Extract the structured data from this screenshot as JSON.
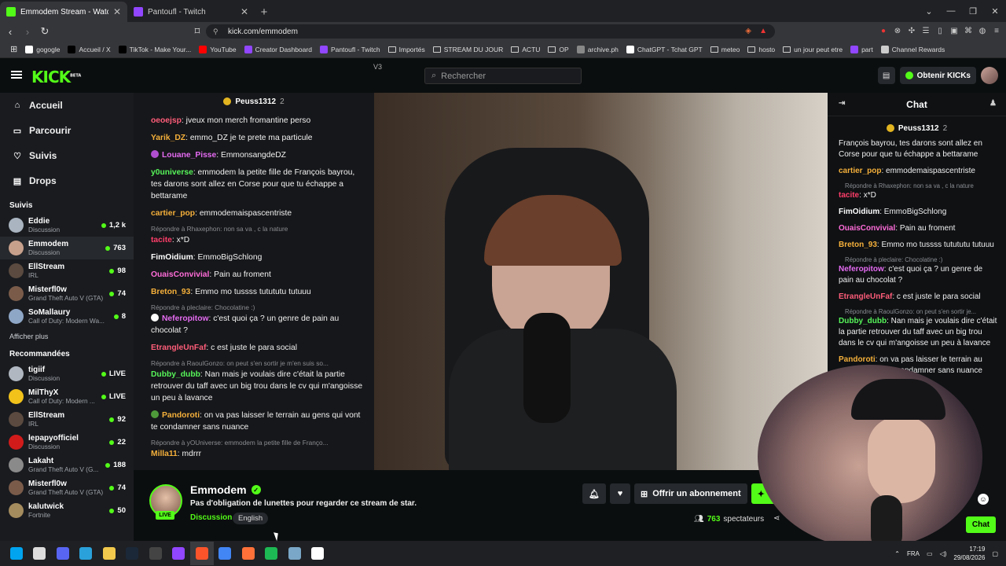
{
  "browser": {
    "tabs": [
      {
        "title": "Emmodem Stream - Watch L",
        "favicon_color": "#53fc18",
        "active": true
      },
      {
        "title": "Pantoufl - Twitch",
        "favicon_color": "#9146ff",
        "active": false
      }
    ],
    "url": "kick.com/emmodem",
    "bookmarks": [
      {
        "label": "gogogle",
        "icon": "google-icon",
        "color": "#ffffff"
      },
      {
        "label": "Accueil / X",
        "icon": "x-icon",
        "color": "#000000"
      },
      {
        "label": "TikTok - Make Your...",
        "icon": "tiktok-icon",
        "color": "#000000"
      },
      {
        "label": "YouTube",
        "icon": "youtube-icon",
        "color": "#ff0000"
      },
      {
        "label": "Creator Dashboard",
        "icon": "twitch-icon",
        "color": "#9146ff"
      },
      {
        "label": "Pantoufl - Twitch",
        "icon": "twitch-icon",
        "color": "#9146ff"
      },
      {
        "label": "Importés",
        "icon": "folder-icon",
        "color": ""
      },
      {
        "label": "STREAM DU JOUR",
        "icon": "folder-icon",
        "color": ""
      },
      {
        "label": "ACTU",
        "icon": "folder-icon",
        "color": ""
      },
      {
        "label": "OP",
        "icon": "folder-icon",
        "color": ""
      },
      {
        "label": "archive.ph",
        "icon": "archive-icon",
        "color": "#888888"
      },
      {
        "label": "ChatGPT - Tchat GPT",
        "icon": "chatgpt-icon",
        "color": "#ffffff"
      },
      {
        "label": "meteo",
        "icon": "folder-icon",
        "color": ""
      },
      {
        "label": "hosto",
        "icon": "folder-icon",
        "color": ""
      },
      {
        "label": "un jour peut etre",
        "icon": "folder-icon",
        "color": ""
      },
      {
        "label": "part",
        "icon": "twitch-icon",
        "color": "#9146ff"
      },
      {
        "label": "Channel Rewards",
        "icon": "rewards-icon",
        "color": "#cccccc"
      }
    ]
  },
  "kick": {
    "logo": "KICK",
    "logo_badge": "BETA",
    "search_placeholder": "Rechercher",
    "get_kicks": "Obtenir KICKs",
    "colors": {
      "accent": "#53fc18"
    }
  },
  "sidebar": {
    "nav": [
      {
        "label": "Accueil",
        "icon": "home-icon"
      },
      {
        "label": "Parcourir",
        "icon": "browse-icon"
      },
      {
        "label": "Suivis",
        "icon": "heart-icon"
      },
      {
        "label": "Drops",
        "icon": "drops-icon"
      }
    ],
    "followed_title": "Suivis",
    "followed": [
      {
        "name": "Eddie",
        "category": "Discussion",
        "viewers": "1,2 k",
        "color": "#a9b4c0"
      },
      {
        "name": "Emmodem",
        "category": "Discussion",
        "viewers": "763",
        "color": "#c7a08c",
        "selected": true
      },
      {
        "name": "EllStream",
        "category": "IRL",
        "viewers": "98",
        "color": "#5a4a3f"
      },
      {
        "name": "Misterfl0w",
        "category": "Grand Theft Auto V (GTA)",
        "viewers": "74",
        "color": "#7a5b4a"
      },
      {
        "name": "SoMallaury",
        "category": "Call of Duty: Modern Wa...",
        "viewers": "8",
        "color": "#8fa7c7"
      }
    ],
    "show_more": "Afficher plus",
    "recommended_title": "Recommandées",
    "recommended": [
      {
        "name": "tigiif",
        "category": "Discussion",
        "viewers": "LIVE",
        "color": "#b0b7c0"
      },
      {
        "name": "MilThyX",
        "category": "Call of Duty: Modern ...",
        "viewers": "LIVE",
        "color": "#f2c21b"
      },
      {
        "name": "EllStream",
        "category": "IRL",
        "viewers": "92",
        "color": "#5a4a3f"
      },
      {
        "name": "lepapyofficiel",
        "category": "Discussion",
        "viewers": "22",
        "color": "#d11b1b"
      },
      {
        "name": "Lakaht",
        "category": "Grand Theft Auto V (G...",
        "viewers": "188",
        "color": "#8a8a8a"
      },
      {
        "name": "Misterfl0w",
        "category": "Grand Theft Auto V (GTA)",
        "viewers": "74",
        "color": "#7a5b4a"
      },
      {
        "name": "kalutwick",
        "category": "Fortnite",
        "viewers": "50",
        "color": "#a58c5e"
      }
    ]
  },
  "video_chat": {
    "pinned_user": "Peuss1312",
    "pinned_count": "2",
    "messages": [
      {
        "user": "oeoejsp",
        "color": "#ff5d7a",
        "text": "jveux mon merch fromantine perso"
      },
      {
        "user": "Yarik_DZ",
        "color": "#f5b03b",
        "text": "emmo_DZ je te prete ma particule"
      },
      {
        "user": "Louane_Pisse",
        "color": "#e56bf2",
        "text": "EmmonsangdeDZ",
        "badge": "#b04fd0"
      },
      {
        "user": "y0universe",
        "color": "#57f55a",
        "text": "emmodem la petite fille de François bayrou, tes darons sont allez en Corse pour que tu échappe a bettarame"
      },
      {
        "user": "cartier_pop",
        "color": "#f5b03b",
        "text": "emmodemaispascentriste"
      },
      {
        "reply": "Répondre à Rhaxephon: non sa va , c la nature"
      },
      {
        "user": "tacite",
        "color": "#ff3e6a",
        "text": "x*D"
      },
      {
        "user": "FimOidium",
        "color": "#ffffff",
        "text": "EmmoBigSchlong"
      },
      {
        "user": "OuaisConvivial",
        "color": "#ff6cd9",
        "text": "Pain au froment"
      },
      {
        "user": "Breton_93",
        "color": "#f5b03b",
        "text": "Emmo mo tussss tutututu tutuuu"
      },
      {
        "reply": "Répondre à pleclaire: Chocolatine :)"
      },
      {
        "user": "Neferopitow",
        "color": "#e56bf2",
        "text": "c'est quoi ça ? un genre de pain au chocolat ?",
        "badge": "#ffffff"
      },
      {
        "user": "EtrangleUnFaf",
        "color": "#ff5d7a",
        "text": "c est juste le para social"
      },
      {
        "reply": "Répondre à RaoulGonzo: on peut s'en sortir je m'en suis so..."
      },
      {
        "user": "Dubby_dubb",
        "color": "#57f55a",
        "text": "Nan mais je voulais dire c'était la partie retrouver du taff avec un big trou dans le cv qui m'angoisse un peu à lavance"
      },
      {
        "user": "Pandoroti",
        "color": "#f5b03b",
        "text": "on va pas laisser le terrain au gens qui vont te condamner sans nuance",
        "badge": "#4e9a3a"
      },
      {
        "reply": "Répondre à yOUniverse: emmodem la petite fille de Franço..."
      },
      {
        "user": "Milla11",
        "color": "#f5b03b",
        "text": "mdrrr"
      }
    ]
  },
  "chat_panel": {
    "title": "Chat",
    "pinned_user": "Peuss1312",
    "pinned_count": "2",
    "messages": [
      {
        "text": "François bayrou, tes darons sont allez en Corse pour que tu échappe a bettarame"
      },
      {
        "user": "cartier_pop",
        "color": "#f5b03b",
        "text": "emmodemaispascentriste"
      },
      {
        "reply": "Répondre à Rhaxephon: non sa va , c la nature"
      },
      {
        "user": "tacite",
        "color": "#ff3e6a",
        "text": "x*D"
      },
      {
        "user": "FimOidium",
        "color": "#ffffff",
        "text": "EmmoBigSchlong"
      },
      {
        "user": "OuaisConvivial",
        "color": "#ff6cd9",
        "text": "Pain au froment"
      },
      {
        "user": "Breton_93",
        "color": "#f5b03b",
        "text": "Emmo mo tussss tutututu tutuuu"
      },
      {
        "reply": "Répondre à pleclaire: Chocolatine :)"
      },
      {
        "user": "Neferopitow",
        "color": "#e56bf2",
        "text": "c'est quoi ça ? un genre de pain au chocolat ?"
      },
      {
        "user": "EtrangleUnFaf",
        "color": "#ff5d7a",
        "text": "c est juste le para social"
      },
      {
        "reply": "Répondre à RaoulGonzo: on peut s'en sortir je..."
      },
      {
        "user": "Dubby_dubb",
        "color": "#57f55a",
        "text": "Nan mais je voulais dire c'était la partie retrouver du taff avec un big trou dans le cv qui m'angoisse un peu à lavance"
      },
      {
        "user": "Pandoroti",
        "color": "#f5b03b",
        "text": "on va pas laisser le terrain au gens qui vont te condamner sans nuance"
      }
    ],
    "chat_button": "Chat"
  },
  "stream": {
    "name": "Emmodem",
    "title": "Pas d'obligation de lunettes pour regarder ce stream de star.",
    "category": "Discussion",
    "tag": "English",
    "live": "LIVE",
    "subscribe": "Offrir un abonnement",
    "follow_partial": "S",
    "viewers": "763",
    "viewers_label": "spectateurs"
  },
  "taskbar": {
    "apps": [
      "windows-icon",
      "search-icon",
      "discord-icon",
      "telegram-icon",
      "files-icon",
      "steam-icon",
      "obs-icon",
      "twitch-icon",
      "brave-icon",
      "chrome-icon",
      "firefox-icon",
      "spotify-icon",
      "settings-icon",
      "capcut-icon"
    ],
    "app_colors": [
      "#00a4ef",
      "#dddddd",
      "#5865f2",
      "#2aa1da",
      "#f2c94c",
      "#1b2838",
      "#444444",
      "#9146ff",
      "#fb542b",
      "#4285f4",
      "#ff7139",
      "#1db954",
      "#7aa7c7",
      "#ffffff"
    ],
    "lang": "FRA",
    "time": "17:19",
    "date": "29/08/2026"
  }
}
